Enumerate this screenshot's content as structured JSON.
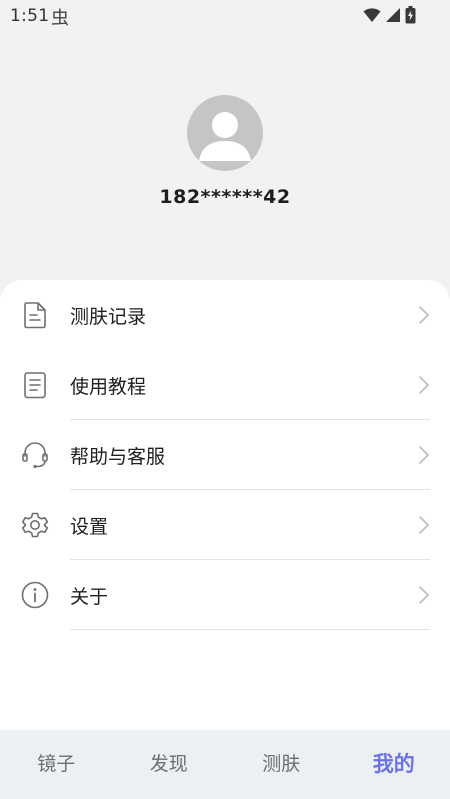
{
  "status_bar": {
    "time": "1:51",
    "notification_glyph": "虫",
    "icons": [
      "wifi-icon",
      "cellular-signal-icon",
      "battery-charging-icon"
    ]
  },
  "profile": {
    "avatar_icon": "default-avatar-icon",
    "phone": "182******42"
  },
  "menu": [
    {
      "label": "测肤记录",
      "icon": "document-icon"
    },
    {
      "label": "使用教程",
      "icon": "list-document-icon"
    },
    {
      "label": "帮助与客服",
      "icon": "headset-icon"
    },
    {
      "label": "设置",
      "icon": "gear-icon"
    },
    {
      "label": "关于",
      "icon": "info-icon"
    }
  ],
  "bottom_nav": {
    "tabs": [
      {
        "label": "镜子"
      },
      {
        "label": "发现"
      },
      {
        "label": "测肤"
      },
      {
        "label": "我的"
      }
    ],
    "active_index": 3,
    "active_color": "#6b74e6"
  }
}
